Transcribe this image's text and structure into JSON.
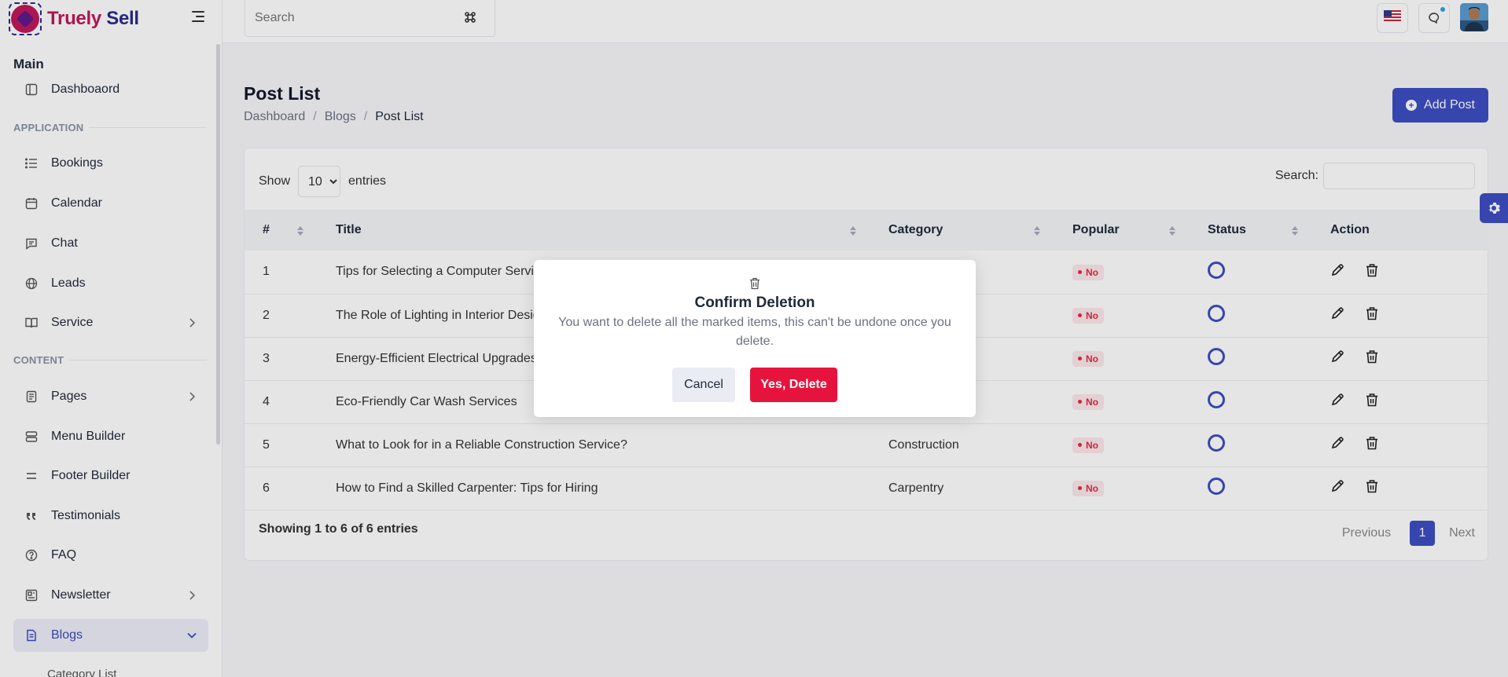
{
  "brand": {
    "part1": "Truely",
    "part2": "Sell"
  },
  "topbar": {
    "search_placeholder": "Search"
  },
  "sidebar": {
    "main_label": "Main",
    "dashboard": "Dashboaord",
    "application_label": "APPLICATION",
    "bookings": "Bookings",
    "calendar": "Calendar",
    "chat": "Chat",
    "leads": "Leads",
    "service": "Service",
    "content_label": "CONTENT",
    "pages": "Pages",
    "menu_builder": "Menu Builder",
    "footer_builder": "Footer Builder",
    "testimonials": "Testimonials",
    "faq": "FAQ",
    "newsletter": "Newsletter",
    "blogs": "Blogs",
    "category_list": "Category List"
  },
  "page": {
    "title": "Post List",
    "breadcrumb": [
      "Dashboard",
      "Blogs",
      "Post List"
    ],
    "add_button": "Add Post"
  },
  "table": {
    "show_label": "Show",
    "entries_value": "10",
    "entries_label": "entries",
    "search_label": "Search:",
    "headers": [
      "#",
      "Title",
      "Category",
      "Popular",
      "Status",
      "Action"
    ],
    "rows": [
      {
        "num": "1",
        "title": "Tips for Selecting a Computer Servic",
        "category": "",
        "popular": "No"
      },
      {
        "num": "2",
        "title": "The Role of Lighting in Interior Desig",
        "category": "",
        "popular": "No"
      },
      {
        "num": "3",
        "title": "Energy-Efficient Electrical Upgrades",
        "category": "",
        "popular": "No"
      },
      {
        "num": "4",
        "title": "Eco-Friendly Car Wash Services",
        "category": "",
        "popular": "No"
      },
      {
        "num": "5",
        "title": "What to Look for in a Reliable Construction Service?",
        "category": "Construction",
        "popular": "No"
      },
      {
        "num": "6",
        "title": "How to Find a Skilled Carpenter: Tips for Hiring",
        "category": "Carpentry",
        "popular": "No"
      }
    ],
    "showing": "Showing 1 to 6 of 6 entries",
    "pager": {
      "previous": "Previous",
      "current": "1",
      "next": "Next"
    }
  },
  "modal": {
    "title": "Confirm Deletion",
    "message": "You want to delete all the marked items, this can't be undone once you delete.",
    "cancel": "Cancel",
    "confirm": "Yes, Delete"
  },
  "colors": {
    "primary": "#3d4fc2",
    "danger": "#e6143d",
    "brand_pink": "#c0195a",
    "brand_navy": "#2b2b8a"
  }
}
